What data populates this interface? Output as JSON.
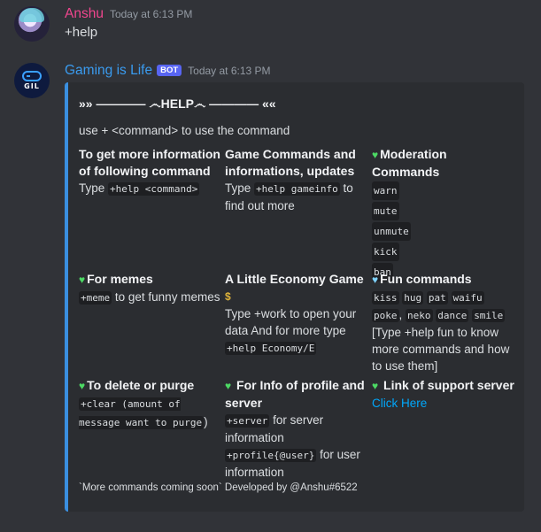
{
  "message1": {
    "username": "Anshu",
    "timestamp": "Today at 6:13 PM",
    "content": "+help",
    "avatar_icon": "user-avatar"
  },
  "message2": {
    "username": "Gaming is Life",
    "bot_tag": "BOT",
    "timestamp": "Today at 6:13 PM",
    "avatar_icon": "gamepad-logo",
    "avatar_text": "GIL"
  },
  "embed": {
    "accent_color": "#3a8fe0",
    "title": "»» ———— ෴HELP෴ ———— ««",
    "description": "use + <command> to use the command",
    "fields": {
      "info": {
        "name": "To get more information of following command",
        "prefix": "Type",
        "code": "+help <command>"
      },
      "game": {
        "name": "Game Commands and informations, updates",
        "prefix": "Type",
        "code": "+help gameinfo",
        "suffix": "to find out more"
      },
      "moderation": {
        "name": "Moderation Commands",
        "codes": [
          "warn",
          "mute",
          "unmute",
          "kick",
          "ban"
        ]
      },
      "memes": {
        "name": "For memes",
        "code": "+meme",
        "suffix": "to get funny memes"
      },
      "economy": {
        "name": "A Little Economy Game",
        "text": "Type +work to open your data And for more type",
        "code": "+help Economy/E"
      },
      "fun": {
        "name": "Fun commands",
        "codes": [
          "kiss",
          "hug",
          "pat",
          "waifu",
          "poke",
          "neko",
          "dance",
          "smile"
        ],
        "sep": ",",
        "note": "[Type +help fun to know more commands and how to use them]"
      },
      "purge": {
        "name": "To delete or purge",
        "code": "+clear (amount of message want to purge",
        "suffix": ")"
      },
      "profile": {
        "name": "For Info of profile and server",
        "code1": "+server",
        "text1": "for server information",
        "code2": "+profile{@user}",
        "text2": "for user information"
      },
      "support": {
        "name": "Link of support server",
        "link": "Click Here"
      }
    },
    "footer": "`More commands coming soon` Developed by @Anshu#6522"
  }
}
